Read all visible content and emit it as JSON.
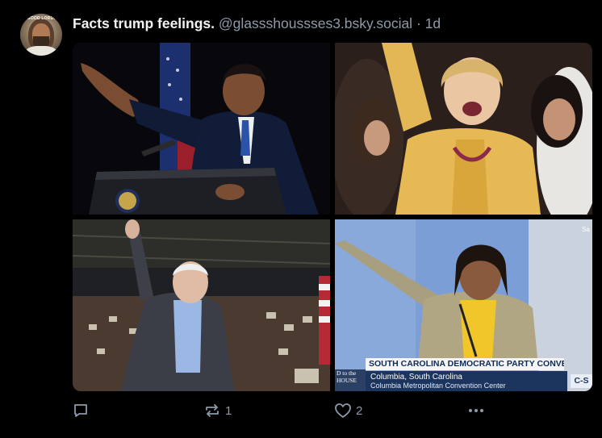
{
  "post": {
    "author": "Facts trump feelings.",
    "handle": "@glassshoussses3.bsky.social",
    "separator": "·",
    "time": "1d",
    "avatar": {
      "caption": "GOOD LORD!"
    }
  },
  "images": [
    {
      "subject": "man-at-podium-waving"
    },
    {
      "subject": "woman-in-yellow-cheering"
    },
    {
      "subject": "man-waving-at-rally"
    },
    {
      "subject": "woman-pointing-convention",
      "lower_third_title": "SOUTH CAROLINA DEMOCRATIC PARTY CONVENTION",
      "lower_third_line1": "Columbia, South Carolina",
      "lower_third_line2": "Columbia Metropolitan Convention Center",
      "network_logo": "C-S",
      "side_text": "D to the HOUSE",
      "corner_text": "Sa"
    }
  ],
  "actions": {
    "reply_icon": "reply-icon",
    "repost_icon": "repost-icon",
    "repost_count": "1",
    "like_icon": "heart-icon",
    "like_count": "2",
    "more_icon": "more-icon"
  },
  "colors": {
    "background": "#000000",
    "text_primary": "#f1f3f5",
    "text_secondary": "#8d9aa8"
  }
}
